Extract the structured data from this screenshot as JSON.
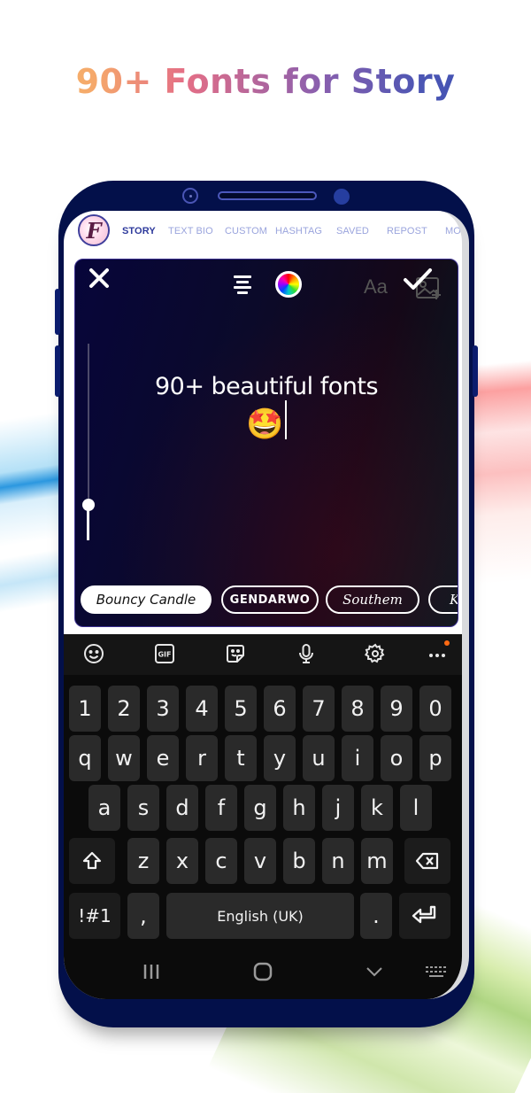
{
  "headline": "90+ Fonts for Story",
  "app": {
    "logo_letter": "F",
    "tabs": [
      {
        "label": "STORY",
        "active": true
      },
      {
        "label": "TEXT BIO",
        "active": false
      },
      {
        "label": "CUSTOM",
        "active": false
      },
      {
        "label": "HASHTAG",
        "active": false
      },
      {
        "label": "SAVED",
        "active": false
      },
      {
        "label": "REPOST",
        "active": false
      },
      {
        "label": "MO",
        "active": false
      }
    ]
  },
  "editor": {
    "toolbar": {
      "close_icon": "close-icon",
      "align_icon": "text-align-center-icon",
      "color_icon": "color-wheel-icon",
      "font_label": "Aa",
      "image_icon": "add-image-icon",
      "done_icon": "checkmark-icon"
    },
    "story_text": "90+ beautiful fonts",
    "story_emoji": "🤩",
    "text_size_slider": {
      "value_fraction": 0.18
    },
    "fonts": [
      {
        "label": "Bouncy Candle",
        "selected": true
      },
      {
        "label": "GENDARWO",
        "selected": false
      },
      {
        "label": "Southem",
        "selected": false
      },
      {
        "label": "K",
        "selected": false
      }
    ]
  },
  "keyboard": {
    "toolbar_icons": [
      "emoji-icon",
      "gif-icon",
      "sticker-icon",
      "microphone-icon",
      "settings-icon",
      "more-icon"
    ],
    "gif_label": "GIF",
    "rows": [
      [
        "1",
        "2",
        "3",
        "4",
        "5",
        "6",
        "7",
        "8",
        "9",
        "0"
      ],
      [
        "q",
        "w",
        "e",
        "r",
        "t",
        "y",
        "u",
        "i",
        "o",
        "p"
      ],
      [
        "a",
        "s",
        "d",
        "f",
        "g",
        "h",
        "j",
        "k",
        "l"
      ],
      [
        "z",
        "x",
        "c",
        "v",
        "b",
        "n",
        "m"
      ]
    ],
    "symbols_label": "!#1",
    "comma_label": ",",
    "space_label": "English (UK)",
    "period_label": "."
  },
  "colors": {
    "phone_frame": "#03104a",
    "active_tab": "#2e3a9c",
    "inactive_tab": "#9aa4dd",
    "notification_dot": "#ff6a13"
  }
}
